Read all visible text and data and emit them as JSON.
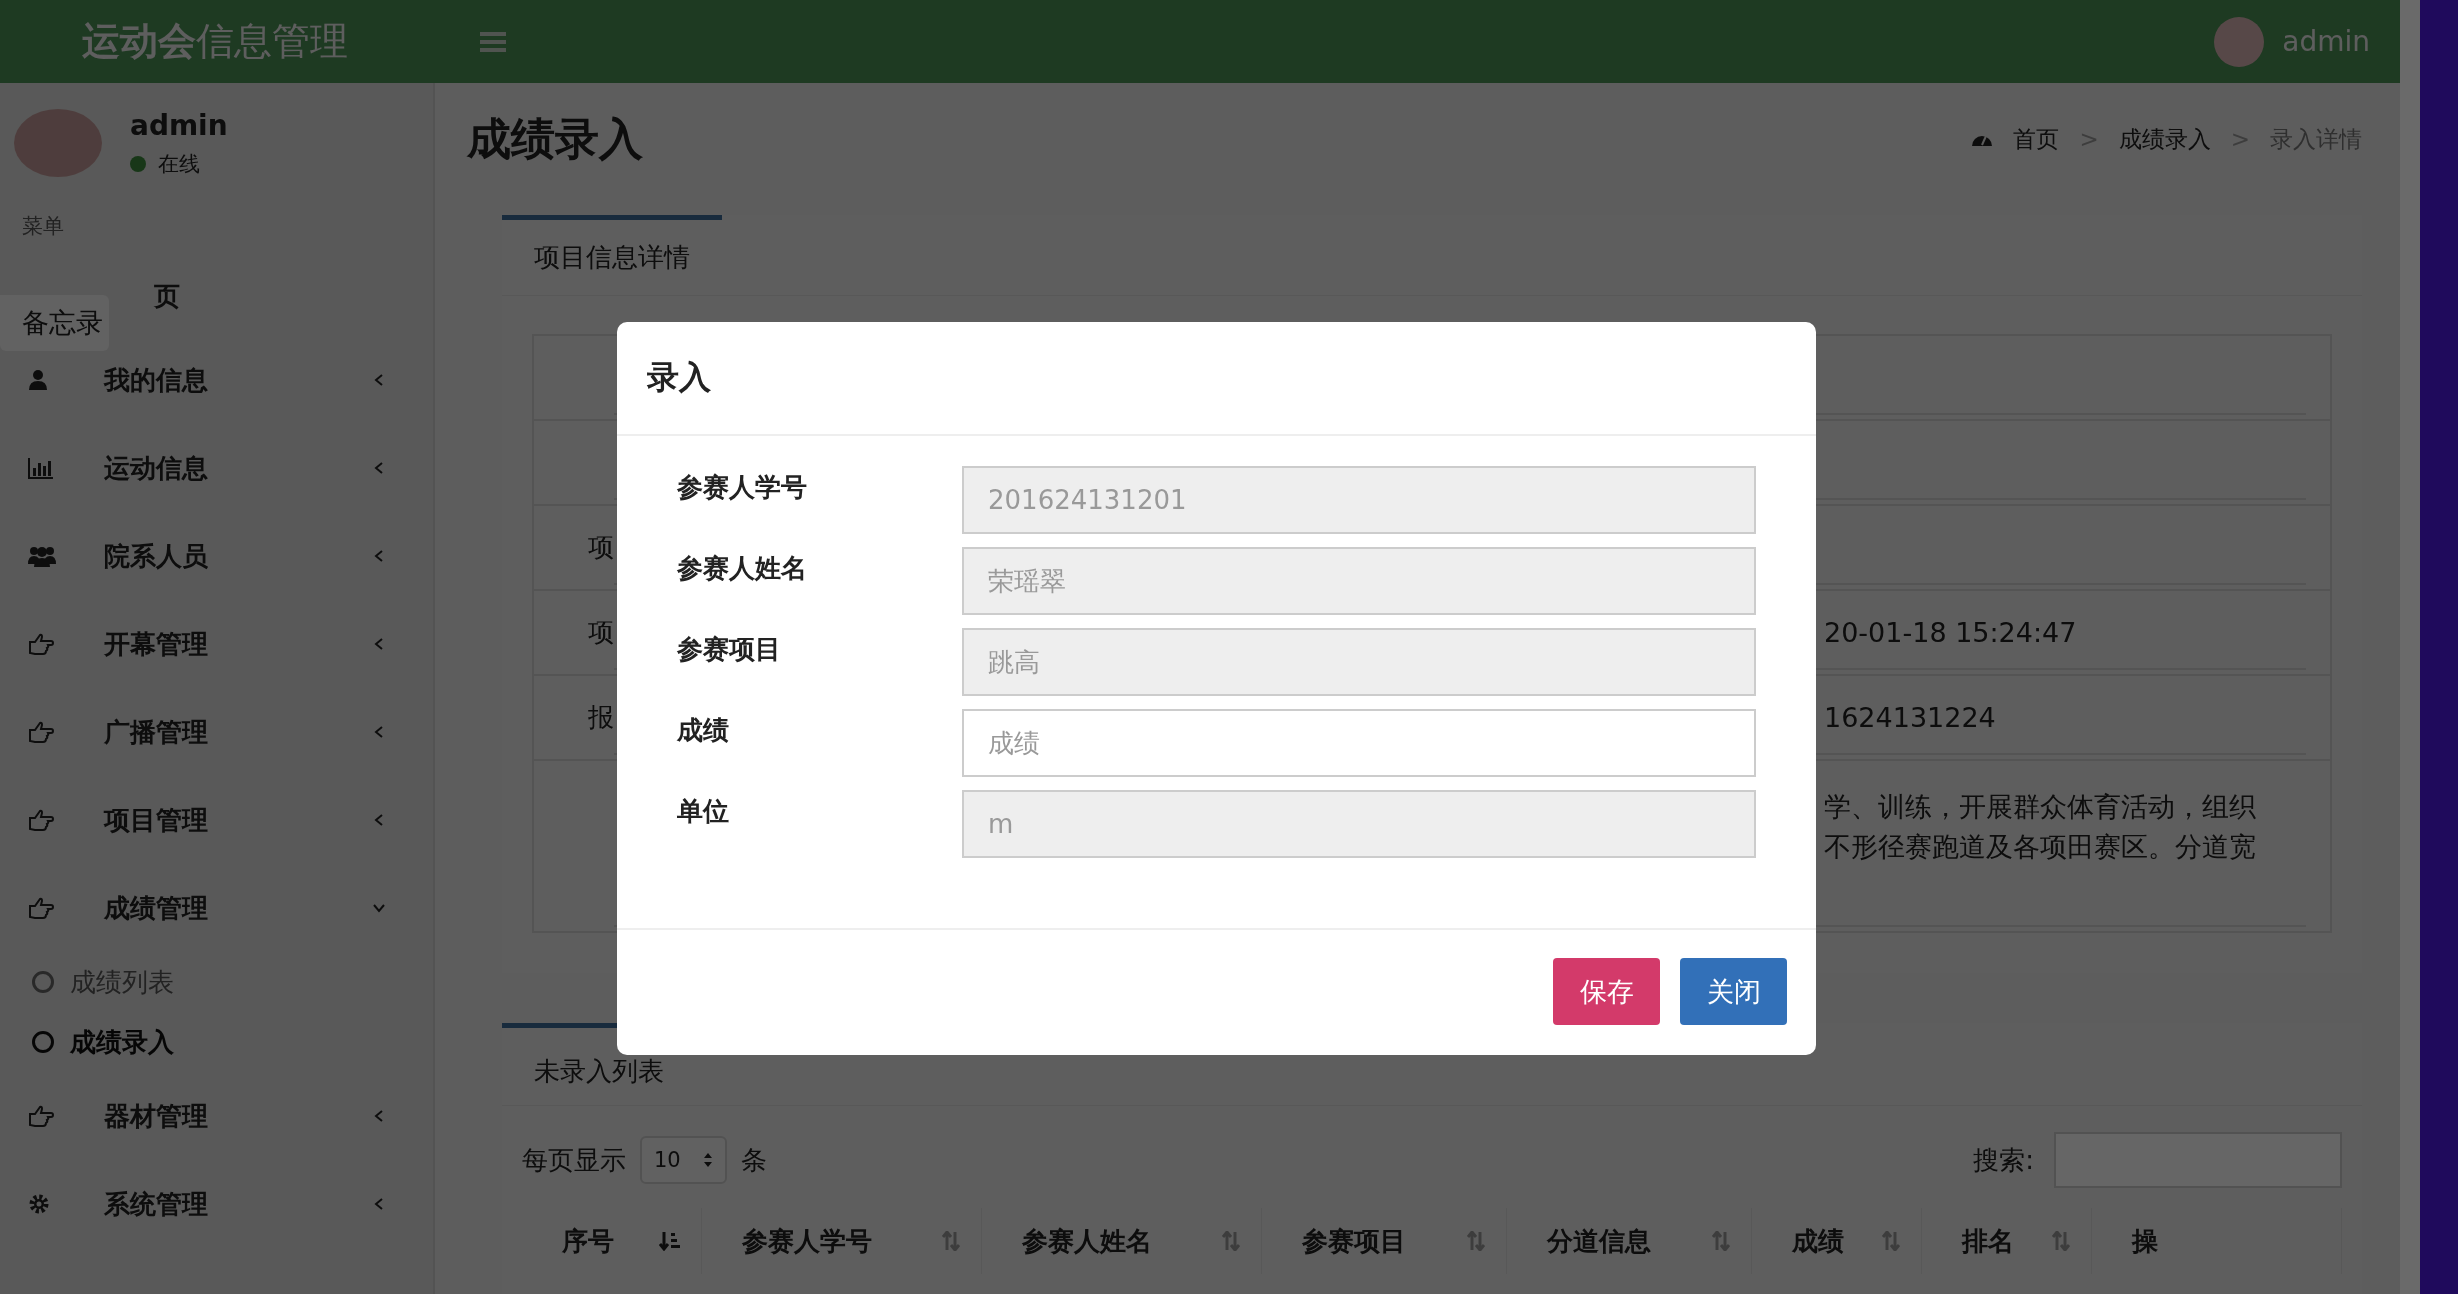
{
  "header": {
    "brand": "**运动会**信息管理",
    "user": "admin"
  },
  "sidebar": {
    "user": {
      "name": "admin",
      "status": "在线"
    },
    "menu_label": "菜单",
    "tooltip": "备忘录",
    "items": [
      {
        "label": "页",
        "has_children": false
      },
      {
        "label": "我的信息",
        "expanded": false,
        "has_children": true
      },
      {
        "label": "运动信息",
        "expanded": false,
        "has_children": true
      },
      {
        "label": "院系人员",
        "expanded": false,
        "has_children": true
      },
      {
        "label": "开幕管理",
        "expanded": false,
        "has_children": true
      },
      {
        "label": "广播管理",
        "expanded": false,
        "has_children": true
      },
      {
        "label": "项目管理",
        "expanded": false,
        "has_children": true
      },
      {
        "label": "成绩管理",
        "expanded": true,
        "has_children": true,
        "children": [
          {
            "label": "成绩列表",
            "selected": false
          },
          {
            "label": "成绩录入",
            "selected": true
          }
        ]
      },
      {
        "label": "器材管理",
        "expanded": false,
        "has_children": true
      },
      {
        "label": "系统管理",
        "expanded": false,
        "has_children": true
      }
    ]
  },
  "page": {
    "title": "成绩录入",
    "breadcrumb": [
      {
        "text": "首页",
        "kind": "link"
      },
      {
        "text": ">",
        "kind": "separator"
      },
      {
        "text": "成绩录入",
        "kind": "link"
      },
      {
        "text": ">",
        "kind": "separator"
      },
      {
        "text": "录入详情",
        "kind": "current"
      }
    ]
  },
  "detail_box": {
    "tab": "项目信息详情",
    "rows": [
      {},
      {},
      {
        "label": "项"
      },
      {
        "label": "项",
        "lines": [
          "20-01-18 15:24:47"
        ]
      },
      {
        "label": "报",
        "lines": [
          "1624131224"
        ]
      },
      {
        "lines": [
          "学、训练，开展群众体育活动，组织",
          "不形径赛跑道及各项田赛区。分道宽"
        ]
      }
    ]
  },
  "list_box": {
    "tab": "未录入列表",
    "length_prefix": "每页显示",
    "length_value": "10",
    "length_suffix": "条",
    "search_label": "搜索:",
    "columns": [
      {
        "label": "序号",
        "sortable": true,
        "sorted": true
      },
      {
        "label": "参赛人学号",
        "sortable": true,
        "sorted": false
      },
      {
        "label": "参赛人姓名",
        "sortable": true,
        "sorted": false
      },
      {
        "label": "参赛项目",
        "sortable": true,
        "sorted": false
      },
      {
        "label": "分道信息",
        "sortable": true,
        "sorted": false
      },
      {
        "label": "成绩",
        "sortable": true,
        "sorted": false
      },
      {
        "label": "排名",
        "sortable": true,
        "sorted": false
      },
      {
        "label": "操",
        "sortable": false
      }
    ]
  },
  "modal": {
    "title": "录入",
    "fields": [
      {
        "label": "参赛人学号",
        "value": "201624131201",
        "disabled": true
      },
      {
        "label": "参赛人姓名",
        "value": "荣瑶翠",
        "disabled": true
      },
      {
        "label": "参赛项目",
        "value": "跳高",
        "disabled": true
      },
      {
        "label": "成绩",
        "placeholder": "成绩",
        "disabled": false
      },
      {
        "label": "单位",
        "value": "m",
        "disabled": true
      }
    ],
    "buttons": [
      {
        "label": "保存",
        "kind": "danger"
      },
      {
        "label": "关闭",
        "kind": "primary"
      }
    ]
  }
}
